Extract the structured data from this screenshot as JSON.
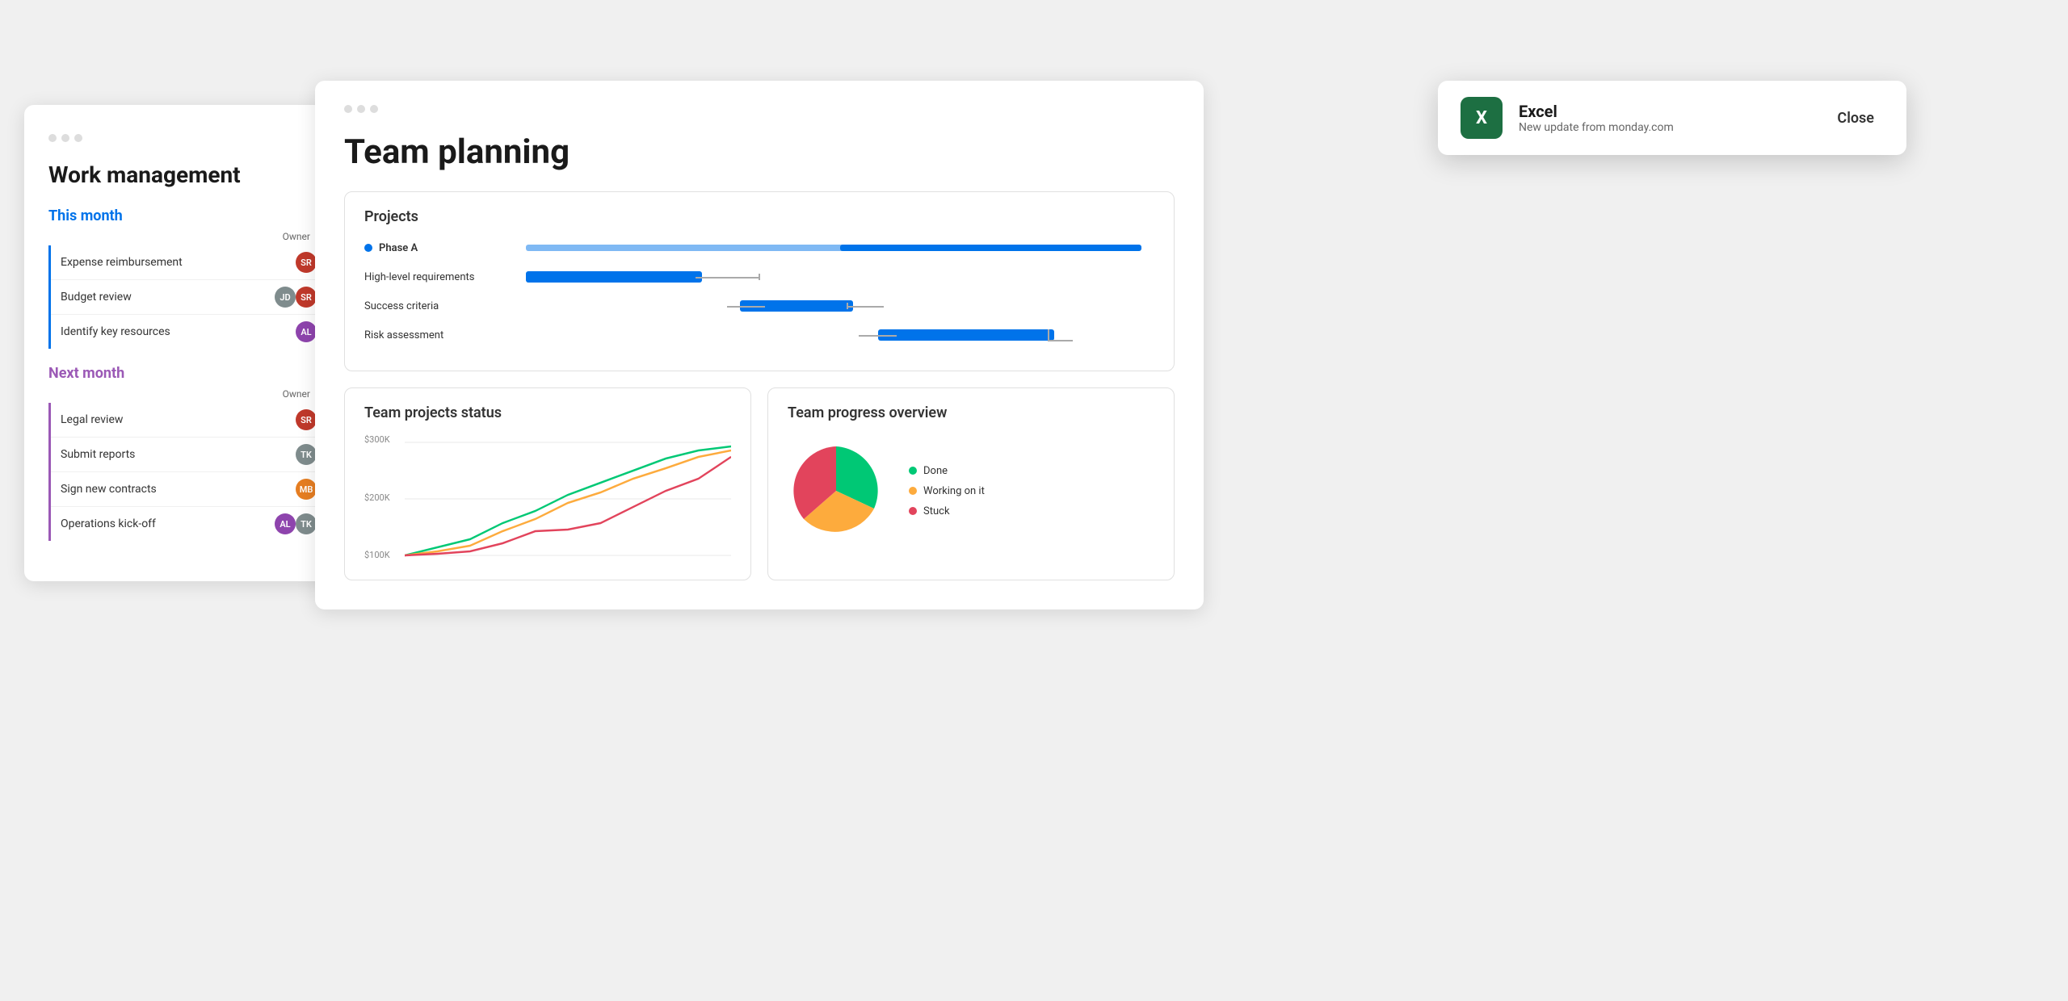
{
  "workMgmt": {
    "title": "Work management",
    "thisMonth": {
      "label": "This month",
      "ownerLabel": "Owner",
      "tasks": [
        {
          "name": "Expense reimbursement",
          "status": "green"
        },
        {
          "name": "Budget review",
          "status": "orange"
        },
        {
          "name": "Identify key resources",
          "status": "green"
        }
      ]
    },
    "nextMonth": {
      "label": "Next month",
      "ownerLabel": "Owner",
      "tasks": [
        {
          "name": "Legal review",
          "status": "green"
        },
        {
          "name": "Submit reports",
          "status": "orange"
        },
        {
          "name": "Sign new contracts",
          "status": "green"
        },
        {
          "name": "Operations kick-off",
          "status": "red"
        }
      ]
    }
  },
  "teamPlanning": {
    "title": "Team planning",
    "projects": {
      "sectionTitle": "Projects",
      "phaseLabel": "Phase A",
      "tasks": [
        {
          "name": "High-level requirements"
        },
        {
          "name": "Success criteria"
        },
        {
          "name": "Risk assessment"
        }
      ]
    },
    "teamStatus": {
      "title": "Team projects status",
      "yLabels": [
        "$300K",
        "$200K",
        "$100K"
      ]
    },
    "teamProgress": {
      "title": "Team progress overview",
      "legend": [
        {
          "label": "Done",
          "color": "done"
        },
        {
          "label": "Working on it",
          "color": "working"
        },
        {
          "label": "Stuck",
          "color": "stuck"
        }
      ]
    }
  },
  "notification": {
    "appName": "Excel",
    "message": "New update from monday.com",
    "closeLabel": "Close"
  }
}
